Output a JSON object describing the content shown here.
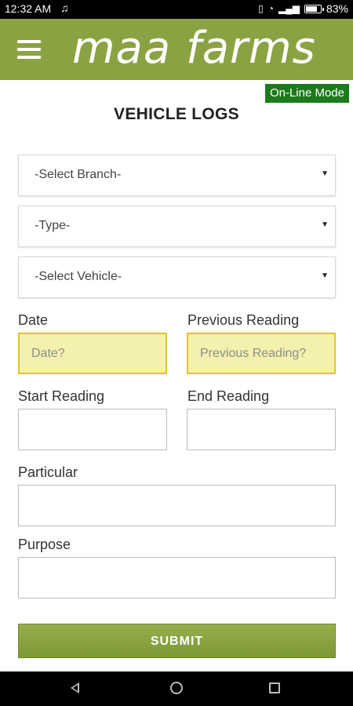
{
  "status_bar": {
    "time": "12:32 AM",
    "music_icon": "music-note-icon",
    "battery_percent": "83%",
    "icons": [
      "vibrate-icon",
      "wifi-icon",
      "signal-icon",
      "battery-icon"
    ]
  },
  "header": {
    "logo_text": "maa farms",
    "menu_icon": "hamburger-menu-icon",
    "brand_color": "#8ba243"
  },
  "mode_badge": "On-Line Mode",
  "page_title": "VEHICLE LOGS",
  "selects": {
    "branch": {
      "value": "-Select Branch-"
    },
    "type": {
      "value": "-Type-"
    },
    "vehicle": {
      "value": "-Select Vehicle-"
    }
  },
  "fields": {
    "date": {
      "label": "Date",
      "placeholder": "Date?"
    },
    "previous_reading": {
      "label": "Previous Reading",
      "placeholder": "Previous Reading?"
    },
    "start_reading": {
      "label": "Start Reading"
    },
    "end_reading": {
      "label": "End Reading"
    },
    "particular": {
      "label": "Particular"
    },
    "purpose": {
      "label": "Purpose"
    }
  },
  "submit_label": "SUBMIT",
  "nav": {
    "back_icon": "back-triangle-icon",
    "home_icon": "home-circle-icon",
    "recent_icon": "recent-apps-square-icon"
  }
}
